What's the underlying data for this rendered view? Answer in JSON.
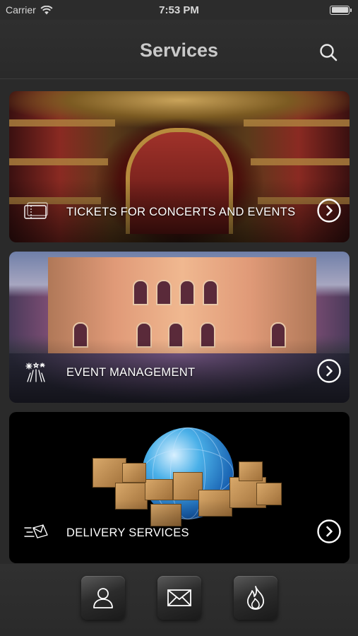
{
  "status_bar": {
    "carrier": "Carrier",
    "time": "7:53 PM",
    "battery_level": 1.0
  },
  "header": {
    "title": "Services",
    "search_icon": "search-icon"
  },
  "services": [
    {
      "label": "TICKETS FOR CONCERTS AND EVENTS",
      "icon": "ticket-icon",
      "arrow_icon": "chevron-right-circle-icon"
    },
    {
      "label": "EVENT MANAGEMENT",
      "icon": "fireworks-icon",
      "arrow_icon": "chevron-right-circle-icon"
    },
    {
      "label": "DELIVERY SERVICES",
      "icon": "fast-mail-icon",
      "arrow_icon": "chevron-right-circle-icon"
    }
  ],
  "tab_bar": {
    "tabs": [
      {
        "icon": "user-icon"
      },
      {
        "icon": "envelope-icon"
      },
      {
        "icon": "flame-icon"
      }
    ]
  },
  "colors": {
    "background": "#2a2a2a",
    "title": "#c9c9c9",
    "text": "#ffffff"
  }
}
